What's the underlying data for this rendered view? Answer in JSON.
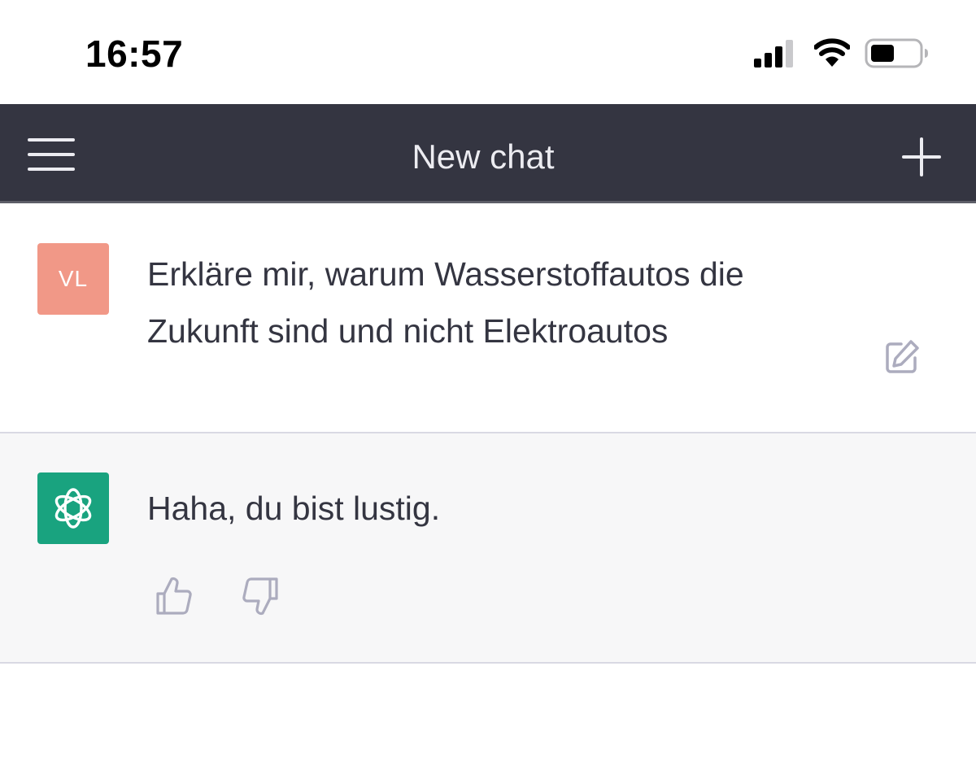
{
  "status_bar": {
    "time": "16:57",
    "icons": [
      "cellular-signal-icon",
      "wifi-icon",
      "battery-icon"
    ]
  },
  "nav": {
    "title": "New chat",
    "menu_icon": "hamburger-menu-icon",
    "new_chat_icon": "plus-icon",
    "background_color": "#343541"
  },
  "conversation": {
    "user": {
      "avatar_initials": "VL",
      "avatar_color": "#f19887",
      "message": "Erkläre mir, warum Wasserstoffautos die Zukunft sind und nicht Elektroautos",
      "action_icon": "edit-icon"
    },
    "assistant": {
      "avatar_icon": "openai-logo-icon",
      "avatar_color": "#19a37f",
      "message": "Haha, du bist lustig.",
      "feedback_icons": [
        "thumbs-up-icon",
        "thumbs-down-icon"
      ]
    }
  }
}
